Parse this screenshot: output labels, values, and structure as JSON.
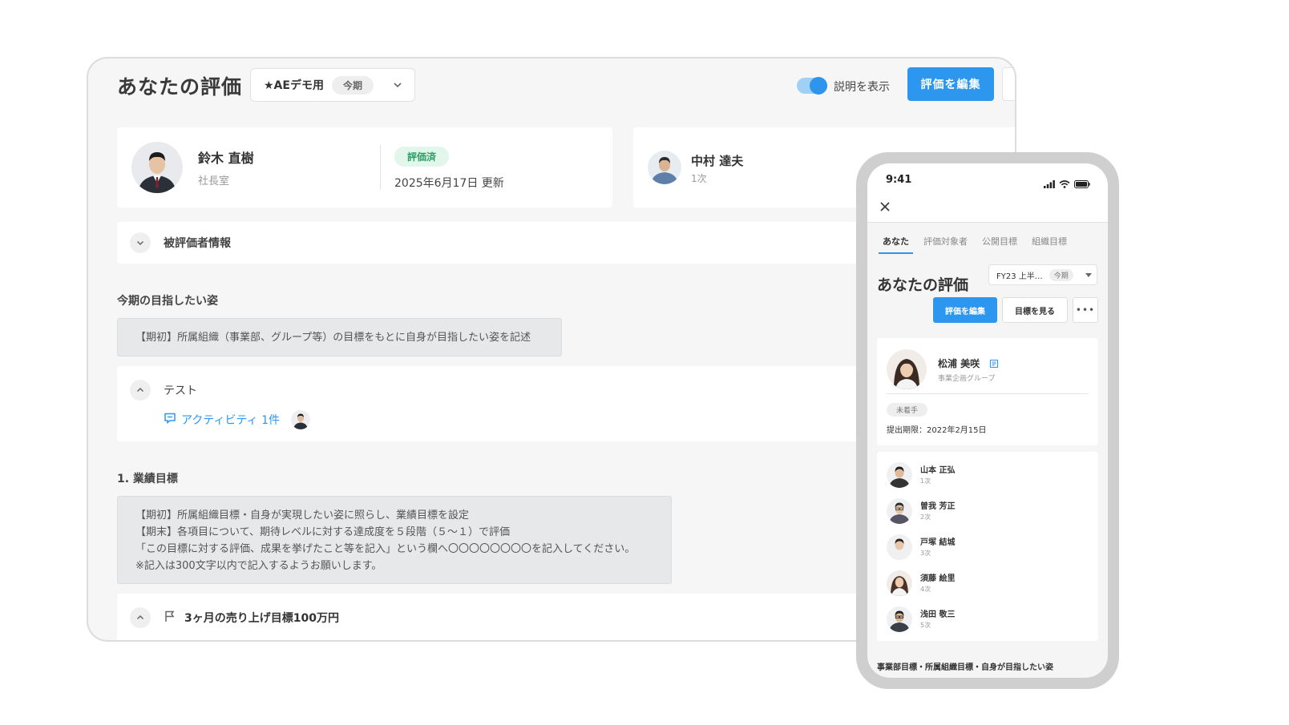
{
  "desktop": {
    "page_title": "あなたの評価",
    "period": {
      "name": "★AEデモ用",
      "badge": "今期"
    },
    "toggle_label": "説明を表示",
    "edit_button": "評価を編集",
    "user": {
      "name": "鈴木 直樹",
      "dept": "社長室",
      "status": "評価済",
      "updated": "2025年6月17日 更新"
    },
    "evaluator": {
      "name": "中村 達夫",
      "order": "1次"
    },
    "section_title": "被評価者情報",
    "aspiration": {
      "heading": "今期の目指したい姿",
      "note": "【期初】所属組織（事業部、グループ等）の目標をもとに自身が目指したい姿を記述",
      "item_title": "テスト",
      "activity": "アクティビティ 1件"
    },
    "performance": {
      "heading": "1. 業績目標",
      "note_lines": [
        "【期初】所属組織目標・自身が実現したい姿に照らし、業績目標を設定",
        "【期末】各項目について、期待レベルに対する達成度を５段階（５〜１）で評価",
        "「この目標に対する評価、成果を挙げたこと等を記入」という欄へ〇〇〇〇〇〇〇〇を記入してください。",
        "※記入は300文字以内で記入するようお願いします。"
      ],
      "goal_title": "3ヶ月の売り上げ目標100万円"
    }
  },
  "mobile": {
    "time": "9:41",
    "tabs": [
      {
        "label": "あなた",
        "active": true
      },
      {
        "label": "評価対象者",
        "active": false
      },
      {
        "label": "公開目標",
        "active": false
      },
      {
        "label": "組織目標",
        "active": false
      }
    ],
    "page_title": "あなたの評価",
    "period": {
      "name": "FY23 上半…",
      "badge": "今期"
    },
    "edit_button": "評価を編集",
    "goals_button": "目標を見る",
    "more_button": "•••",
    "user": {
      "name": "松浦 美咲",
      "dept": "事業企画グループ",
      "status": "未着手",
      "deadline": "提出期限：2022年2月15日"
    },
    "evaluators": [
      {
        "name": "山本 正弘",
        "order": "1次"
      },
      {
        "name": "曽我 芳正",
        "order": "2次"
      },
      {
        "name": "戸塚 結城",
        "order": "3次"
      },
      {
        "name": "須藤 絵里",
        "order": "4次"
      },
      {
        "name": "浅田 敬三",
        "order": "5次"
      }
    ],
    "footer": "事業部目標・所属組織目標・自身が目指したい姿"
  },
  "colors": {
    "accent": "#2d97f0",
    "status_done": "#27a265",
    "status_done_bg": "#e3f6ec"
  },
  "icons": [
    "chevron-down-icon",
    "chevron-up-icon",
    "comment-icon",
    "flag-icon",
    "close-icon",
    "signal-icon",
    "wifi-icon",
    "battery-icon",
    "profile-card-icon"
  ]
}
